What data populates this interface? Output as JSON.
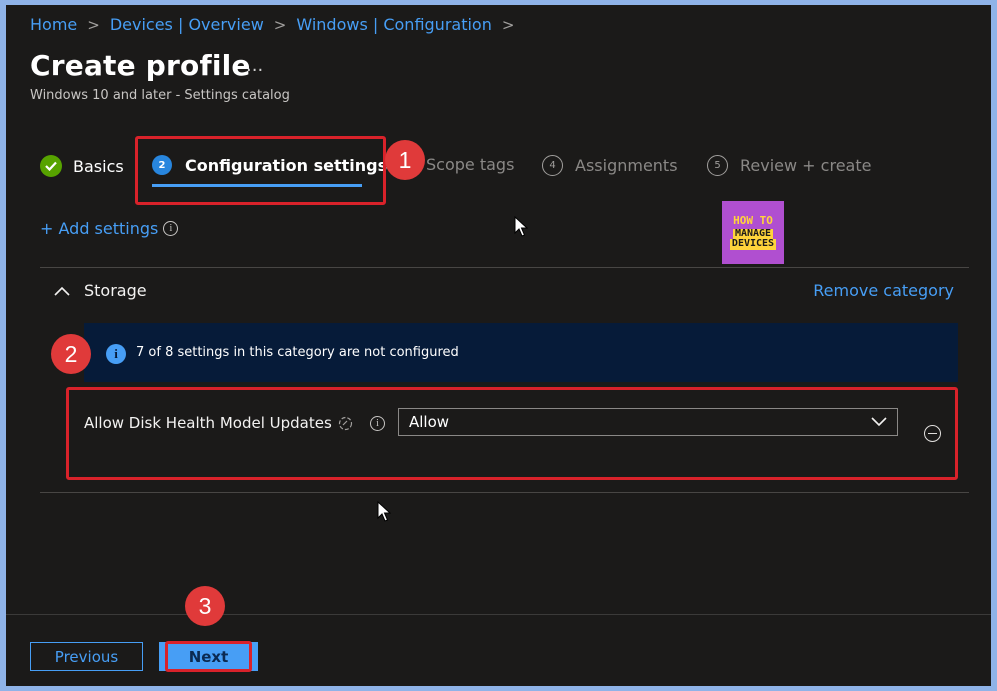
{
  "breadcrumb": {
    "items": [
      "Home",
      "Devices | Overview",
      "Windows | Configuration"
    ],
    "separator": ">"
  },
  "header": {
    "title": "Create profile",
    "more": "...",
    "subtitle": "Windows 10 and later - Settings catalog"
  },
  "steps": [
    {
      "number": "",
      "label": "Basics",
      "state": "completed"
    },
    {
      "number": "2",
      "label": "Configuration settings",
      "state": "active"
    },
    {
      "number": "",
      "label": "Scope tags",
      "state": "pending"
    },
    {
      "number": "4",
      "label": "Assignments",
      "state": "pending"
    },
    {
      "number": "5",
      "label": "Review + create",
      "state": "pending"
    }
  ],
  "actions": {
    "add_settings": "+ Add settings",
    "info_glyph": "i"
  },
  "logo": {
    "line1": "HOW TO",
    "line2": "MANAGE",
    "line3": "DEVICES"
  },
  "category": {
    "name": "Storage",
    "remove_label": "Remove category",
    "banner": "7 of 8 settings in this category are not configured",
    "banner_icon": "i"
  },
  "setting": {
    "label": "Allow Disk Health Model Updates",
    "value": "Allow"
  },
  "footer": {
    "previous_label": "Previous",
    "next_label": "Next"
  },
  "annotations": {
    "badge1": "1",
    "badge2": "2",
    "badge3": "3"
  },
  "colors": {
    "accent": "#479ef5",
    "background": "#1b1a19",
    "banner": "#061b39",
    "highlight": "#d9222a",
    "success": "#57a300"
  },
  "icons": [
    "chevron-right-icon",
    "checkmark-icon",
    "info-icon",
    "chevron-up-icon",
    "chevron-down-icon",
    "sync-icon",
    "remove-icon",
    "mouse-cursor-icon"
  ]
}
